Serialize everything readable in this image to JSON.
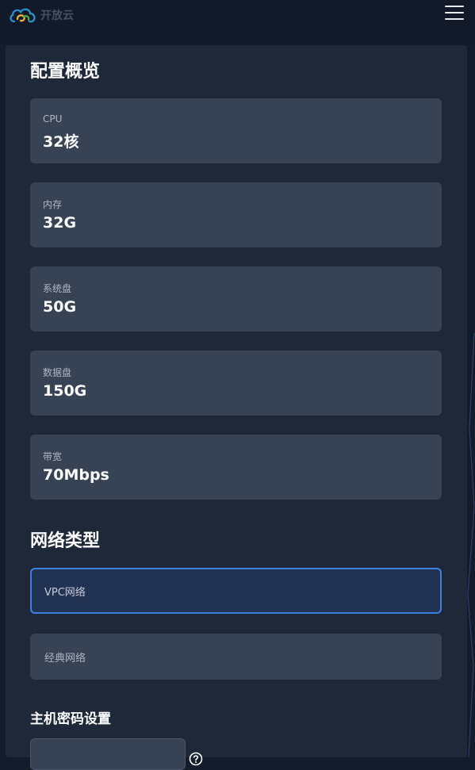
{
  "brand": {
    "name": "开放云",
    "logo_icon": "cloud-logo-icon"
  },
  "header": {
    "menu_icon": "hamburger-menu-icon"
  },
  "overview": {
    "title": "配置概览",
    "specs": [
      {
        "label": "CPU",
        "value": "32核"
      },
      {
        "label": "内存",
        "value": "32G"
      },
      {
        "label": "系统盘",
        "value": "50G"
      },
      {
        "label": "数据盘",
        "value": "150G"
      },
      {
        "label": "带宽",
        "value": "70Mbps"
      }
    ]
  },
  "network": {
    "title": "网络类型",
    "options": [
      {
        "label": "VPC网络",
        "selected": true
      },
      {
        "label": "经典网络",
        "selected": false
      }
    ]
  },
  "password": {
    "title": "主机密码设置",
    "value": "",
    "help_icon": "question-circle-icon"
  },
  "colors": {
    "background": "#141c2b",
    "panel": "#1e2839",
    "card": "#374255",
    "accent": "#3f7fe0"
  }
}
